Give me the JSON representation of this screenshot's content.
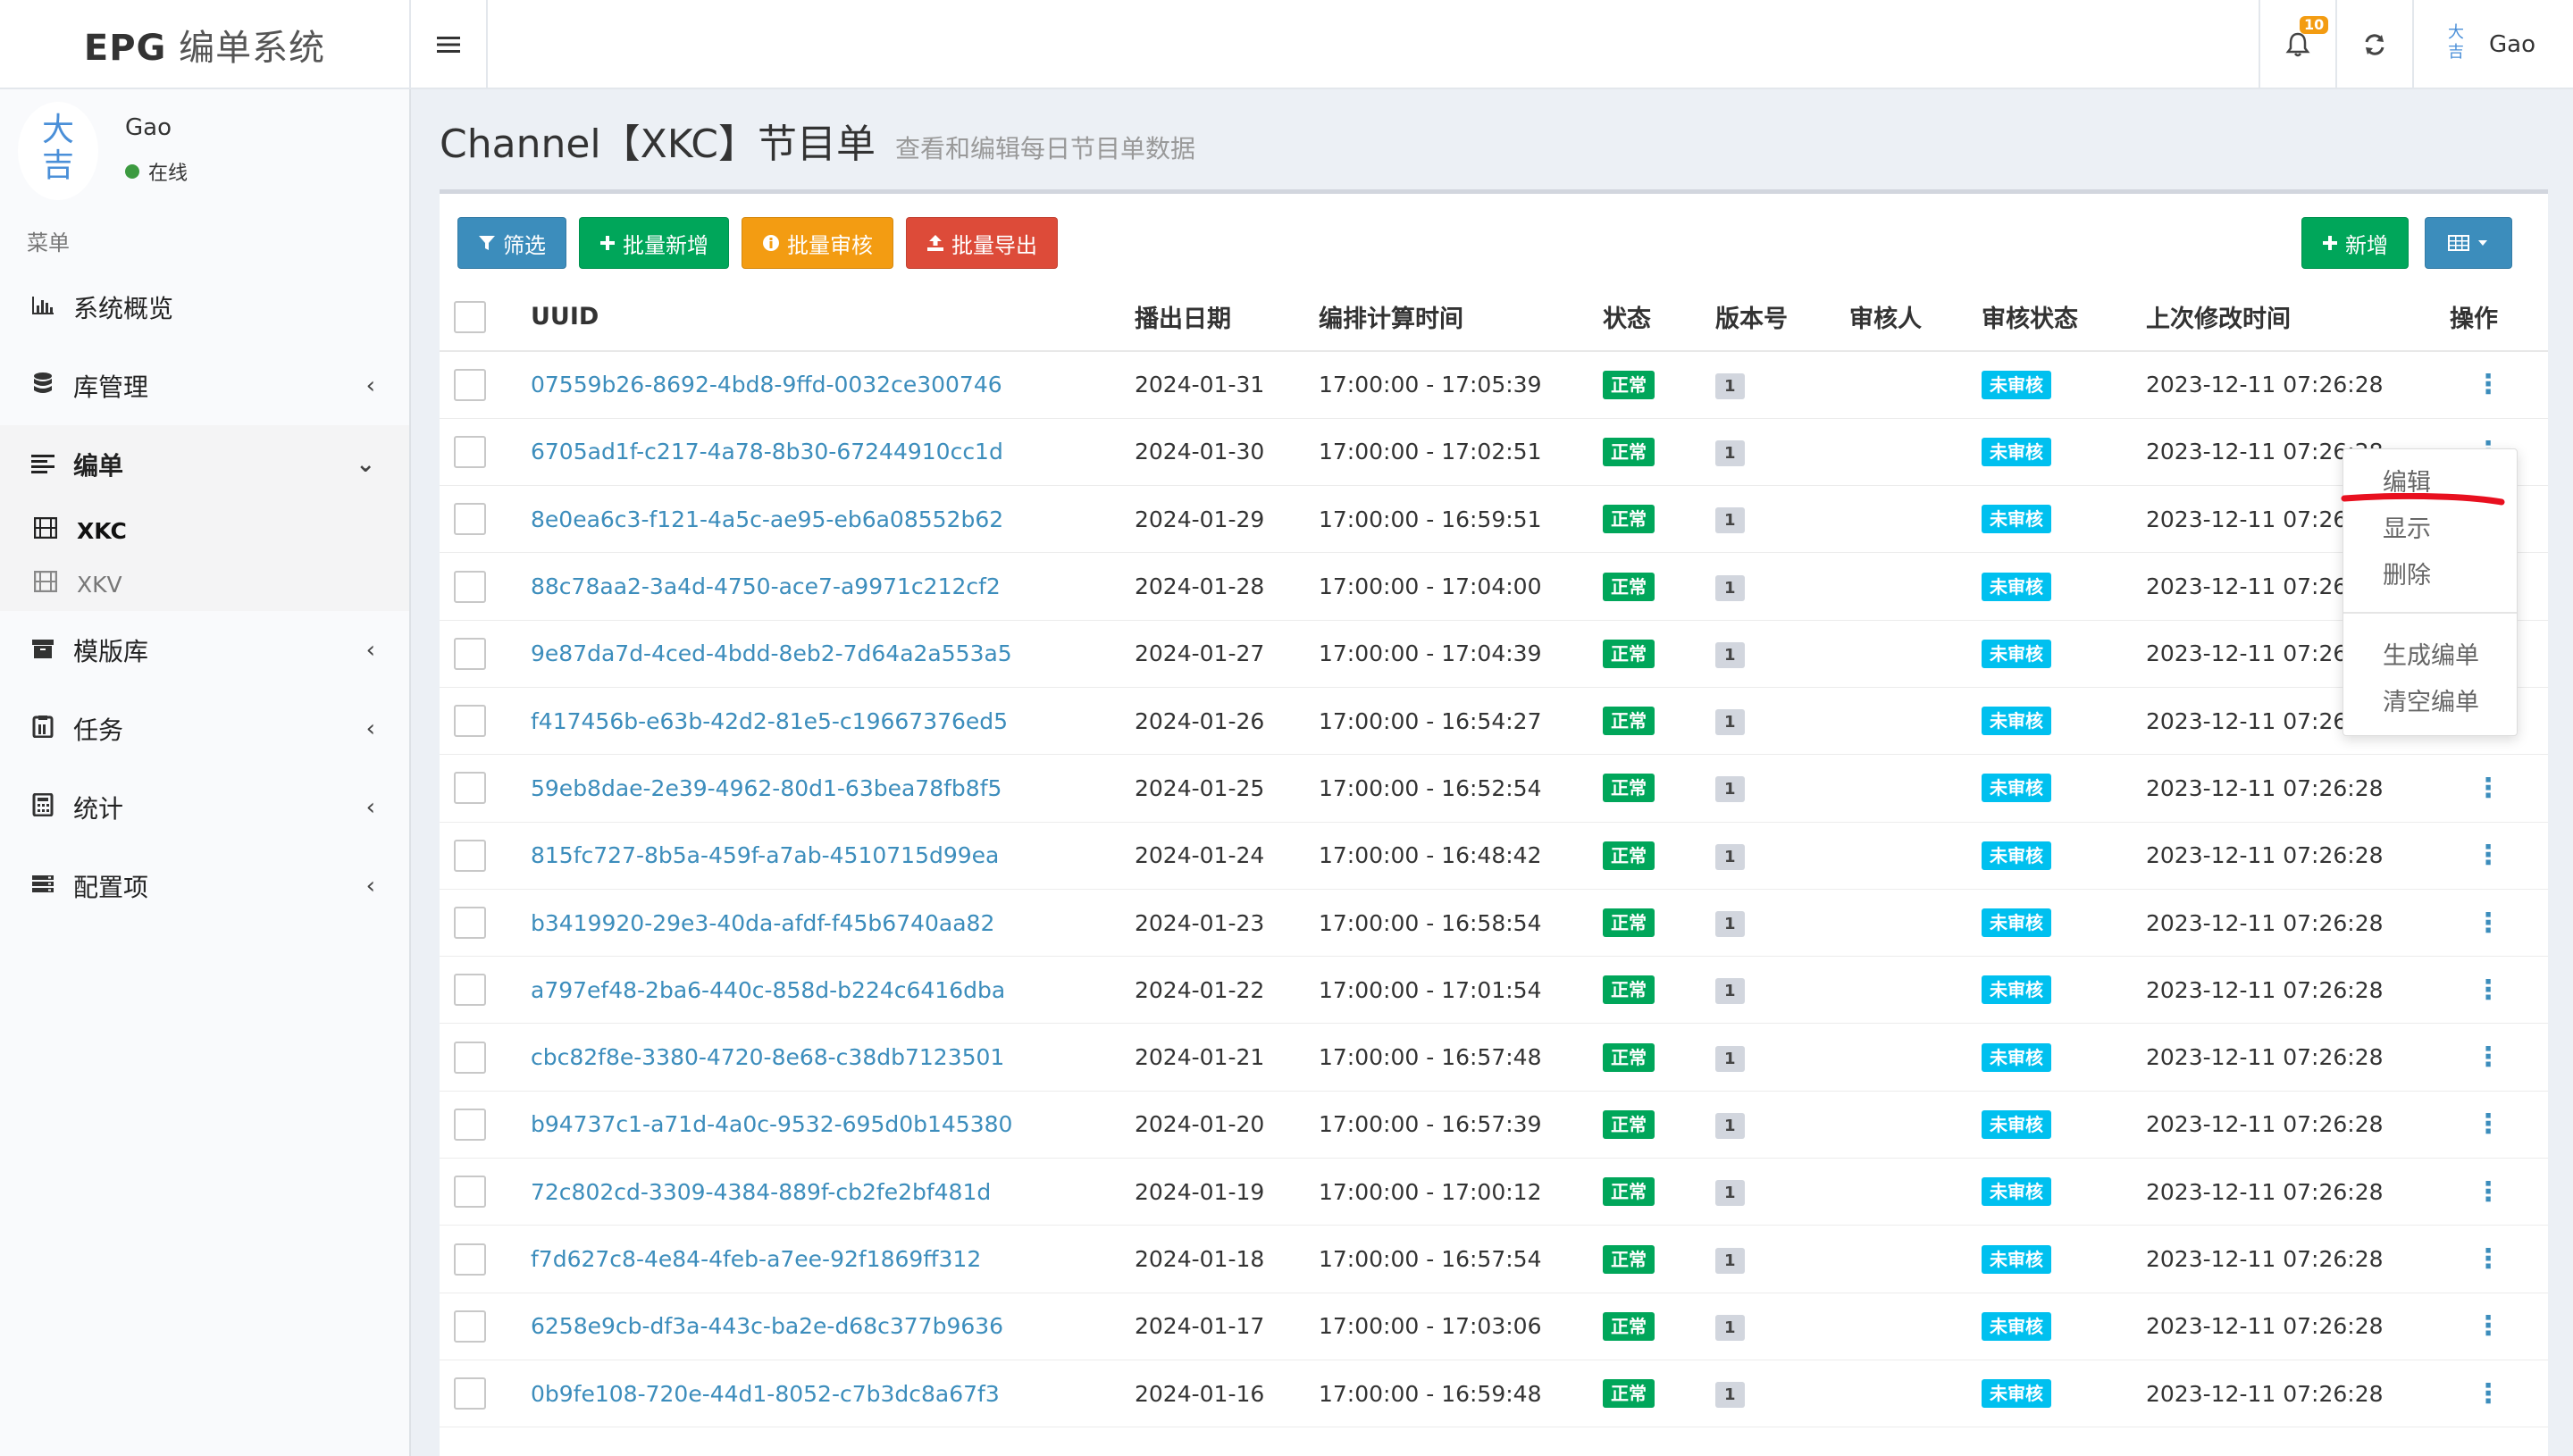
{
  "header": {
    "logo_bold": "EPG",
    "logo_light": "编单系统",
    "notifications_count": "10",
    "username": "Gao",
    "avatar_text": "大吉"
  },
  "sidebar": {
    "user_name": "Gao",
    "user_status": "在线",
    "avatar_text": "大吉",
    "menu_header": "菜单",
    "items": [
      {
        "label": "系统概览"
      },
      {
        "label": "库管理"
      },
      {
        "label": "编单"
      },
      {
        "label": "模版库"
      },
      {
        "label": "任务"
      },
      {
        "label": "统计"
      },
      {
        "label": "配置项"
      }
    ],
    "sub_items": [
      {
        "label": "XKC"
      },
      {
        "label": "XKV"
      }
    ]
  },
  "page": {
    "title": "Channel【XKC】节目单",
    "subtitle": "查看和编辑每日节目单数据"
  },
  "toolbar": {
    "filter": "筛选",
    "batch_add": "批量新增",
    "batch_review": "批量审核",
    "batch_export": "批量导出",
    "add": "新增"
  },
  "table": {
    "headers": [
      "UUID",
      "播出日期",
      "编排计算时间",
      "状态",
      "版本号",
      "审核人",
      "审核状态",
      "上次修改时间",
      "操作"
    ],
    "rows": [
      {
        "uuid": "07559b26-8692-4bd8-9ffd-0032ce300746",
        "date": "2024-01-31",
        "time": "17:00:00 - 17:05:39",
        "state": "正常",
        "version": "1",
        "reviewer": "",
        "review_status": "未审核",
        "modified": "2023-12-11 07:26:28"
      },
      {
        "uuid": "6705ad1f-c217-4a78-8b30-67244910cc1d",
        "date": "2024-01-30",
        "time": "17:00:00 - 17:02:51",
        "state": "正常",
        "version": "1",
        "reviewer": "",
        "review_status": "未审核",
        "modified": "2023-12-11 07:26:28"
      },
      {
        "uuid": "8e0ea6c3-f121-4a5c-ae95-eb6a08552b62",
        "date": "2024-01-29",
        "time": "17:00:00 - 16:59:51",
        "state": "正常",
        "version": "1",
        "reviewer": "",
        "review_status": "未审核",
        "modified": "2023-12-11 07:26:28"
      },
      {
        "uuid": "88c78aa2-3a4d-4750-ace7-a9971c212cf2",
        "date": "2024-01-28",
        "time": "17:00:00 - 17:04:00",
        "state": "正常",
        "version": "1",
        "reviewer": "",
        "review_status": "未审核",
        "modified": "2023-12-11 07:26:28"
      },
      {
        "uuid": "9e87da7d-4ced-4bdd-8eb2-7d64a2a553a5",
        "date": "2024-01-27",
        "time": "17:00:00 - 17:04:39",
        "state": "正常",
        "version": "1",
        "reviewer": "",
        "review_status": "未审核",
        "modified": "2023-12-11 07:26:28"
      },
      {
        "uuid": "f417456b-e63b-42d2-81e5-c19667376ed5",
        "date": "2024-01-26",
        "time": "17:00:00 - 16:54:27",
        "state": "正常",
        "version": "1",
        "reviewer": "",
        "review_status": "未审核",
        "modified": "2023-12-11 07:26:28"
      },
      {
        "uuid": "59eb8dae-2e39-4962-80d1-63bea78fb8f5",
        "date": "2024-01-25",
        "time": "17:00:00 - 16:52:54",
        "state": "正常",
        "version": "1",
        "reviewer": "",
        "review_status": "未审核",
        "modified": "2023-12-11 07:26:28"
      },
      {
        "uuid": "815fc727-8b5a-459f-a7ab-4510715d99ea",
        "date": "2024-01-24",
        "time": "17:00:00 - 16:48:42",
        "state": "正常",
        "version": "1",
        "reviewer": "",
        "review_status": "未审核",
        "modified": "2023-12-11 07:26:28"
      },
      {
        "uuid": "b3419920-29e3-40da-afdf-f45b6740aa82",
        "date": "2024-01-23",
        "time": "17:00:00 - 16:58:54",
        "state": "正常",
        "version": "1",
        "reviewer": "",
        "review_status": "未审核",
        "modified": "2023-12-11 07:26:28"
      },
      {
        "uuid": "a797ef48-2ba6-440c-858d-b224c6416dba",
        "date": "2024-01-22",
        "time": "17:00:00 - 17:01:54",
        "state": "正常",
        "version": "1",
        "reviewer": "",
        "review_status": "未审核",
        "modified": "2023-12-11 07:26:28"
      },
      {
        "uuid": "cbc82f8e-3380-4720-8e68-c38db7123501",
        "date": "2024-01-21",
        "time": "17:00:00 - 16:57:48",
        "state": "正常",
        "version": "1",
        "reviewer": "",
        "review_status": "未审核",
        "modified": "2023-12-11 07:26:28"
      },
      {
        "uuid": "b94737c1-a71d-4a0c-9532-695d0b145380",
        "date": "2024-01-20",
        "time": "17:00:00 - 16:57:39",
        "state": "正常",
        "version": "1",
        "reviewer": "",
        "review_status": "未审核",
        "modified": "2023-12-11 07:26:28"
      },
      {
        "uuid": "72c802cd-3309-4384-889f-cb2fe2bf481d",
        "date": "2024-01-19",
        "time": "17:00:00 - 17:00:12",
        "state": "正常",
        "version": "1",
        "reviewer": "",
        "review_status": "未审核",
        "modified": "2023-12-11 07:26:28"
      },
      {
        "uuid": "f7d627c8-4e84-4feb-a7ee-92f1869ff312",
        "date": "2024-01-18",
        "time": "17:00:00 - 16:57:54",
        "state": "正常",
        "version": "1",
        "reviewer": "",
        "review_status": "未审核",
        "modified": "2023-12-11 07:26:28"
      },
      {
        "uuid": "6258e9cb-df3a-443c-ba2e-d68c377b9636",
        "date": "2024-01-17",
        "time": "17:00:00 - 17:03:06",
        "state": "正常",
        "version": "1",
        "reviewer": "",
        "review_status": "未审核",
        "modified": "2023-12-11 07:26:28"
      },
      {
        "uuid": "0b9fe108-720e-44d1-8052-c7b3dc8a67f3",
        "date": "2024-01-16",
        "time": "17:00:00 - 16:59:48",
        "state": "正常",
        "version": "1",
        "reviewer": "",
        "review_status": "未审核",
        "modified": "2023-12-11 07:26:28"
      }
    ]
  },
  "dropdown": {
    "edit": "编辑",
    "show": "显示",
    "delete": "删除",
    "generate": "生成编单",
    "clear": "清空编单"
  },
  "colors": {
    "primary": "#3c8dbc",
    "success": "#00a65a",
    "warning": "#f39c12",
    "danger": "#dd4b39",
    "info": "#00c0ef",
    "annotation": "#e8101f"
  }
}
